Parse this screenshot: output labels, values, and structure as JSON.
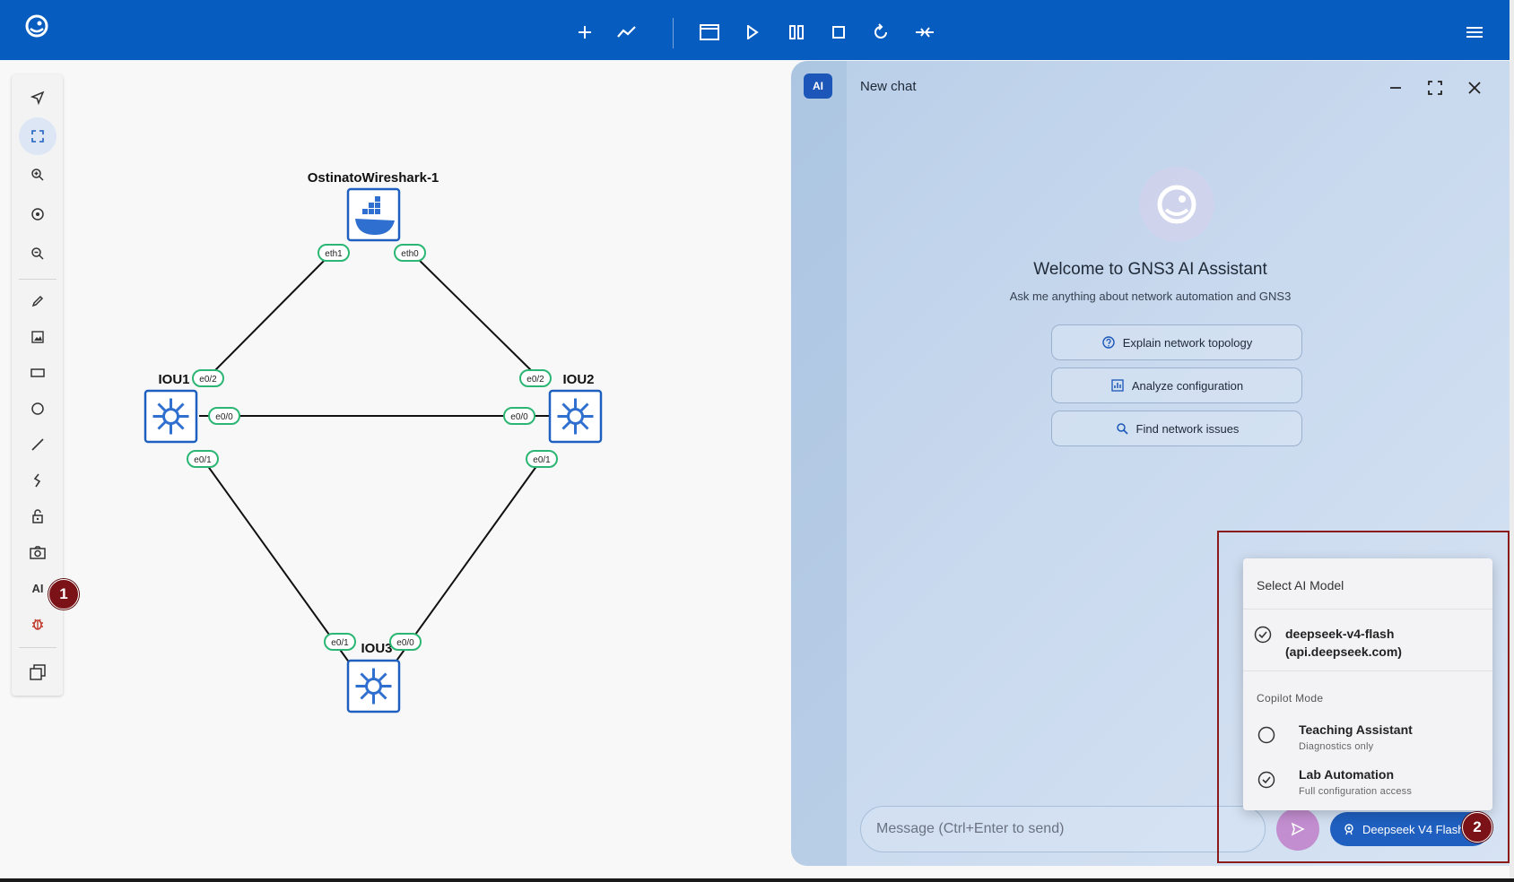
{
  "toolbar": {
    "tools": [
      "select-pointer",
      "fit-screen",
      "zoom-in",
      "reset-zoom",
      "zoom-out",
      "draw-pencil",
      "insert-image",
      "rectangle",
      "ellipse",
      "line",
      "curve",
      "lock",
      "screenshot",
      "ai-assistant",
      "debug",
      "layers"
    ],
    "ai_label": "AI"
  },
  "topology": {
    "nodes": [
      {
        "name": "OstinatoWireshark-1",
        "type": "docker"
      },
      {
        "name": "IOU1",
        "type": "switch"
      },
      {
        "name": "IOU2",
        "type": "switch"
      },
      {
        "name": "IOU3",
        "type": "switch"
      }
    ],
    "ports": {
      "docker_eth1": "eth1",
      "docker_eth0": "eth0",
      "iou1_e02": "e0/2",
      "iou1_e00": "e0/0",
      "iou1_e01": "e0/1",
      "iou2_e02": "e0/2",
      "iou2_e00": "e0/0",
      "iou2_e01": "e0/1",
      "iou3_e01": "e0/1",
      "iou3_e00": "e0/0"
    }
  },
  "chat": {
    "ai_chip": "AI",
    "title": "New chat",
    "welcome_title": "Welcome to GNS3 AI Assistant",
    "welcome_subtitle": "Ask me anything about network automation and GNS3",
    "suggestions": [
      "Explain network topology",
      "Analyze configuration",
      "Find network issues"
    ],
    "input_placeholder": "Message (Ctrl+Enter to send)",
    "model_button": "Deepseek V4 Flash"
  },
  "model_menu": {
    "header": "Select AI Model",
    "model_line1": "deepseek-v4-flash",
    "model_line2": "(api.deepseek.com)",
    "copilot_label": "Copilot Mode",
    "modes": [
      {
        "title": "Teaching Assistant",
        "subtitle": "Diagnostics only",
        "selected": false
      },
      {
        "title": "Lab Automation",
        "subtitle": "Full configuration access",
        "selected": true
      }
    ]
  },
  "annotations": [
    "1",
    "2"
  ],
  "colors": {
    "topbar": "#075cbf",
    "accent": "#1f5fbf",
    "port_border": "#2bb673",
    "annotation": "#7a1217",
    "highlight": "#8b1a1a"
  }
}
